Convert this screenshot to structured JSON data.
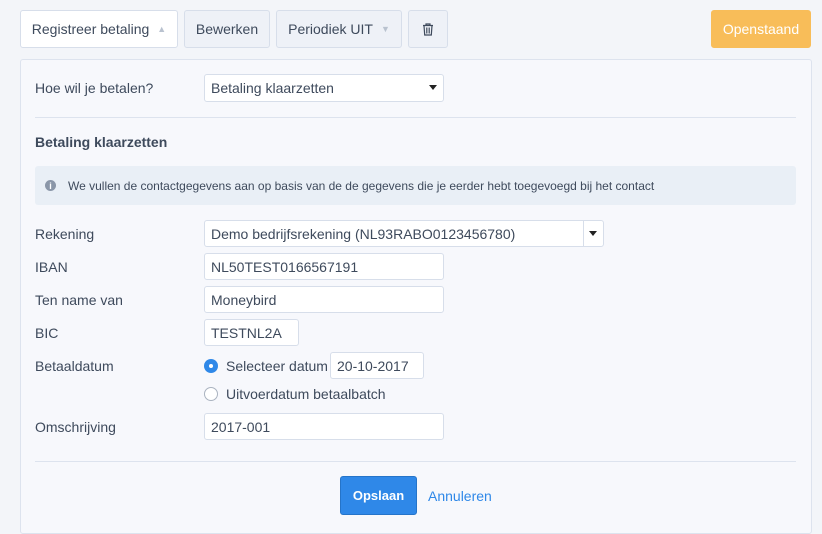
{
  "toolbar": {
    "register_payment": "Registreer betaling",
    "edit": "Bewerken",
    "periodic": "Periodiek UIT",
    "status": "Openstaand"
  },
  "form": {
    "how_label": "Hoe wil je betalen?",
    "how_value": "Betaling klaarzetten",
    "section_title": "Betaling klaarzetten",
    "info": "We vullen de contactgegevens aan op basis van de de gegevens die je eerder hebt toegevoegd bij het contact",
    "account_label": "Rekening",
    "account_value": "Demo bedrijfsrekening (NL93RABO0123456780)",
    "iban_label": "IBAN",
    "iban_value": "NL50TEST0166567191",
    "name_label": "Ten name van",
    "name_value": "Moneybird",
    "bic_label": "BIC",
    "bic_value": "TESTNL2A",
    "date_label": "Betaaldatum",
    "radio_select_date": "Selecteer datum",
    "date_value": "20-10-2017",
    "radio_batch": "Uitvoerdatum betaalbatch",
    "description_label": "Omschrijving",
    "description_value": "2017-001",
    "save": "Opslaan",
    "cancel": "Annuleren"
  },
  "colors": {
    "primary": "#2f88e8",
    "status": "#f8bd59"
  }
}
